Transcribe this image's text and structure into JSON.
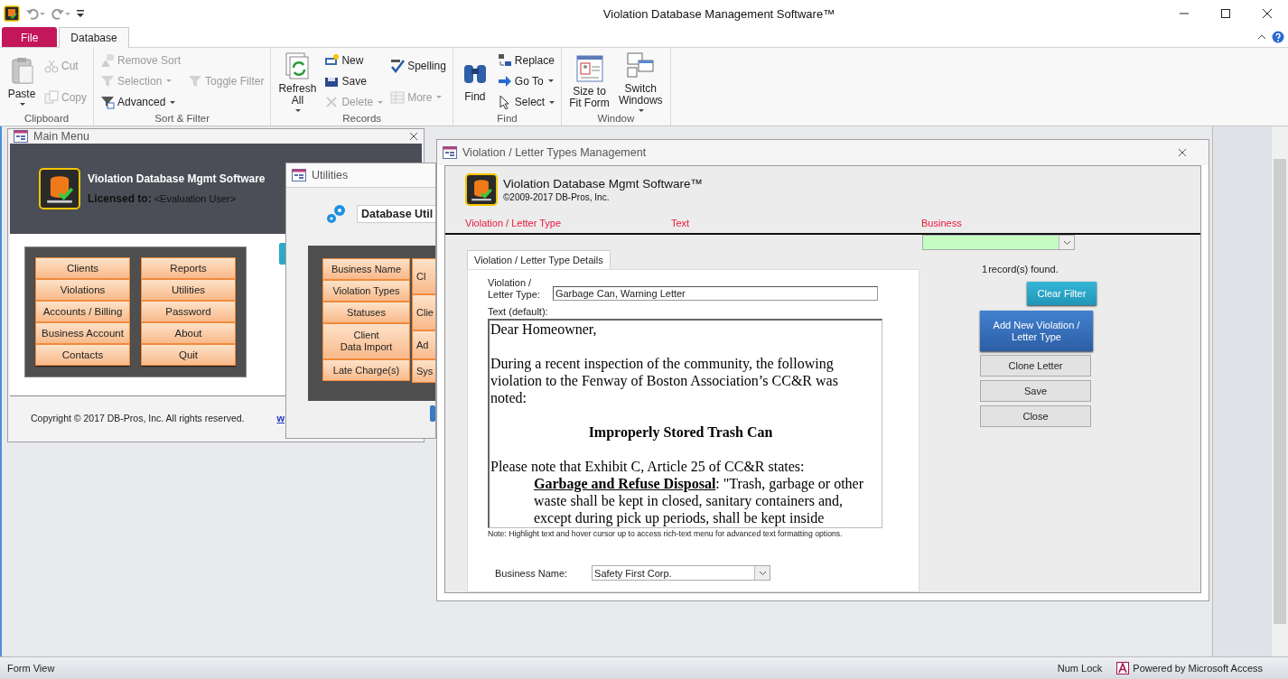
{
  "app": {
    "title": "Violation Database Management Software™"
  },
  "ribbon": {
    "tabs": [
      {
        "label": "File",
        "kind": "file",
        "selected": false
      },
      {
        "label": "Database",
        "kind": "tab",
        "selected": true
      }
    ],
    "groups": [
      {
        "label": "Clipboard",
        "columns": [
          [
            {
              "label": "Paste",
              "kind": "large",
              "disabled": false,
              "dropdown": true
            }
          ],
          [
            {
              "label": "Cut",
              "kind": "small",
              "disabled": true,
              "dropdown": false
            },
            {
              "label": "Copy",
              "kind": "small",
              "disabled": true,
              "dropdown": false
            }
          ]
        ]
      },
      {
        "label": "Sort & Filter",
        "columns": [
          [
            {
              "label": "Remove Sort",
              "kind": "small",
              "disabled": true,
              "dropdown": false
            },
            {
              "label": "Selection",
              "kind": "small",
              "disabled": true,
              "dropdown": true
            },
            {
              "label": "Advanced",
              "kind": "small",
              "disabled": false,
              "dropdown": true
            }
          ],
          [
            {
              "label": "Toggle Filter",
              "kind": "small",
              "disabled": true,
              "dropdown": false
            }
          ]
        ]
      },
      {
        "label": "Records",
        "columns": [
          [
            {
              "label": "Refresh\nAll",
              "kind": "large",
              "disabled": false,
              "dropdown": true
            }
          ],
          [
            {
              "label": "New",
              "kind": "small",
              "disabled": false,
              "dropdown": false
            },
            {
              "label": "Save",
              "kind": "small",
              "disabled": false,
              "dropdown": false
            },
            {
              "label": "Delete",
              "kind": "small",
              "disabled": true,
              "dropdown": true
            }
          ],
          [
            {
              "label": "Spelling",
              "kind": "small",
              "disabled": false,
              "dropdown": false
            },
            {
              "label": "More",
              "kind": "small",
              "disabled": true,
              "dropdown": true
            }
          ]
        ]
      },
      {
        "label": "Find",
        "columns": [
          [
            {
              "label": "Find",
              "kind": "large",
              "disabled": false,
              "dropdown": false
            }
          ],
          [
            {
              "label": "Replace",
              "kind": "small",
              "disabled": false,
              "dropdown": false
            },
            {
              "label": "Go To",
              "kind": "small",
              "disabled": false,
              "dropdown": true
            },
            {
              "label": "Select",
              "kind": "small",
              "disabled": false,
              "dropdown": true
            }
          ]
        ]
      },
      {
        "label": "Window",
        "columns": [
          [
            {
              "label": "Size to\nFit Form",
              "kind": "large",
              "disabled": false,
              "dropdown": false
            }
          ],
          [
            {
              "label": "Switch\nWindows",
              "kind": "large",
              "disabled": false,
              "dropdown": true
            }
          ]
        ]
      }
    ]
  },
  "main_menu": {
    "title": "Main Menu",
    "app_name": "Violation Database Mgmt Software",
    "licensed_label": "Licensed to:",
    "licensee": "<Evaluation User>",
    "button_columns": [
      [
        "Clients",
        "Violations",
        "Accounts / Billing",
        "Business Account",
        "Contacts"
      ],
      [
        "Reports",
        "Utilities",
        "Password",
        "About",
        "Quit"
      ]
    ],
    "copyright": "Copyright © 2017 DB-Pros, Inc.  All rights reserved.",
    "link": "w"
  },
  "utilities": {
    "title": "Utilities",
    "heading": "Database Util",
    "button_columns": [
      [
        "Business Name",
        "Violation Types",
        "Statuses",
        "Client\nData Import",
        "Late Charge(s)"
      ],
      [
        "Cl",
        "Clie",
        "Ad",
        "Sys"
      ]
    ]
  },
  "letter_types": {
    "title": "Violation / Letter Types Management",
    "app_name": "Violation Database Mgmt Software™",
    "copyright": "©2009-2017 DB-Pros, Inc.",
    "filter_headers": [
      "Violation / Letter Type",
      "Text",
      "Business"
    ],
    "record_count": "1",
    "records_label": "record(s) found.",
    "tabs": [
      {
        "label": "Violation / Letter Type Details",
        "selected": true
      }
    ],
    "type_label": "Violation /\nLetter Type:",
    "type_value": "Garbage Can, Warning Letter",
    "text_label": "Text (default):",
    "letter": [
      {
        "kind": "para",
        "text": "Dear Homeowner,"
      },
      {
        "kind": "para",
        "text": "During a recent inspection of the community, the following violation to the Fenway of Boston Association’s CC&R was noted:"
      },
      {
        "kind": "heading",
        "text": "Improperly Stored Trash Can"
      },
      {
        "kind": "lead",
        "text": "Please note that Exhibit C, Article 25 of CC&R states:"
      },
      {
        "kind": "quote",
        "text": "**Garbage and Refuse Disposal**: \"Trash, garbage or other waste shall be kept in closed, sanitary containers and, except during pick up periods, shall be kept inside"
      }
    ],
    "note": "Note: Highlight text and hover cursor up to access rich-text menu for advanced text formatting options.",
    "business_label": "Business Name:",
    "business_value": "Safety First Corp.",
    "buttons": [
      {
        "label": "Clear Filter",
        "kind": "teal"
      },
      {
        "label": "Add New Violation /\nLetter Type",
        "kind": "primary"
      },
      {
        "label": "Clone Letter",
        "kind": "plain"
      },
      {
        "label": "Save",
        "kind": "plain"
      },
      {
        "label": "Close",
        "kind": "plain"
      }
    ]
  },
  "status_bar": {
    "left": "Form View",
    "num_lock": "Num Lock",
    "powered": "Powered by Microsoft Access"
  }
}
